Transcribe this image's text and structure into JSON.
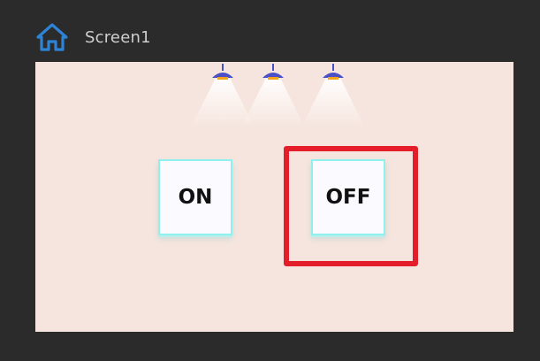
{
  "header": {
    "title": "Screen1",
    "icon": "home-icon",
    "icon_color": "#2d83d6"
  },
  "stage": {
    "background": "#f6e5de",
    "lamps": [
      {
        "name": "ceiling-lamp-1",
        "icon": "ceiling-lamp-icon",
        "state": "on"
      },
      {
        "name": "ceiling-lamp-2",
        "icon": "ceiling-lamp-icon",
        "state": "on"
      },
      {
        "name": "ceiling-lamp-3",
        "icon": "ceiling-lamp-icon",
        "state": "on"
      }
    ],
    "buttons": {
      "on_label": "ON",
      "off_label": "OFF"
    },
    "highlight_color": "#e41d2a"
  }
}
